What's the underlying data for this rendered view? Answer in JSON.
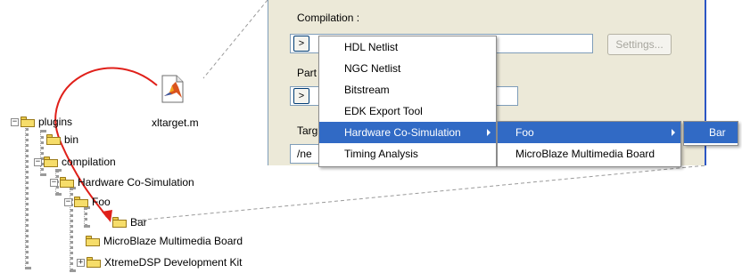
{
  "tree": {
    "items": [
      {
        "label": "plugins",
        "expander": "−"
      },
      {
        "label": "bin",
        "expander": ""
      },
      {
        "label": "compilation",
        "expander": "−"
      },
      {
        "label": "Hardware Co-Simulation",
        "expander": "−"
      },
      {
        "label": "Foo",
        "expander": "−"
      },
      {
        "label": "Bar",
        "expander": ""
      },
      {
        "label": "MicroBlaze Multimedia Board",
        "expander": ""
      },
      {
        "label": "XtremeDSP Development Kit",
        "expander": "+"
      }
    ]
  },
  "file": {
    "label": "xltarget.m",
    "icon": "matlab-file-icon"
  },
  "dialog": {
    "compilation_label": "Compilation :",
    "part_label": "Part",
    "target_label": "Targ",
    "path_prefix": "/ne",
    "settings_label": "Settings...",
    "expand_glyph": ">"
  },
  "menu": {
    "items": [
      {
        "label": "HDL Netlist"
      },
      {
        "label": "NGC Netlist"
      },
      {
        "label": "Bitstream"
      },
      {
        "label": "EDK Export Tool"
      },
      {
        "label": "Hardware Co-Simulation"
      },
      {
        "label": "Timing Analysis"
      }
    ]
  },
  "submenu": {
    "items": [
      {
        "label": "Foo"
      },
      {
        "label": "MicroBlaze Multimedia Board"
      }
    ]
  },
  "submenu2": {
    "items": [
      {
        "label": "Bar"
      }
    ]
  },
  "colors": {
    "highlight": "#316ac5",
    "arrow": "#e0201a",
    "folder": "#f6dd6a"
  }
}
